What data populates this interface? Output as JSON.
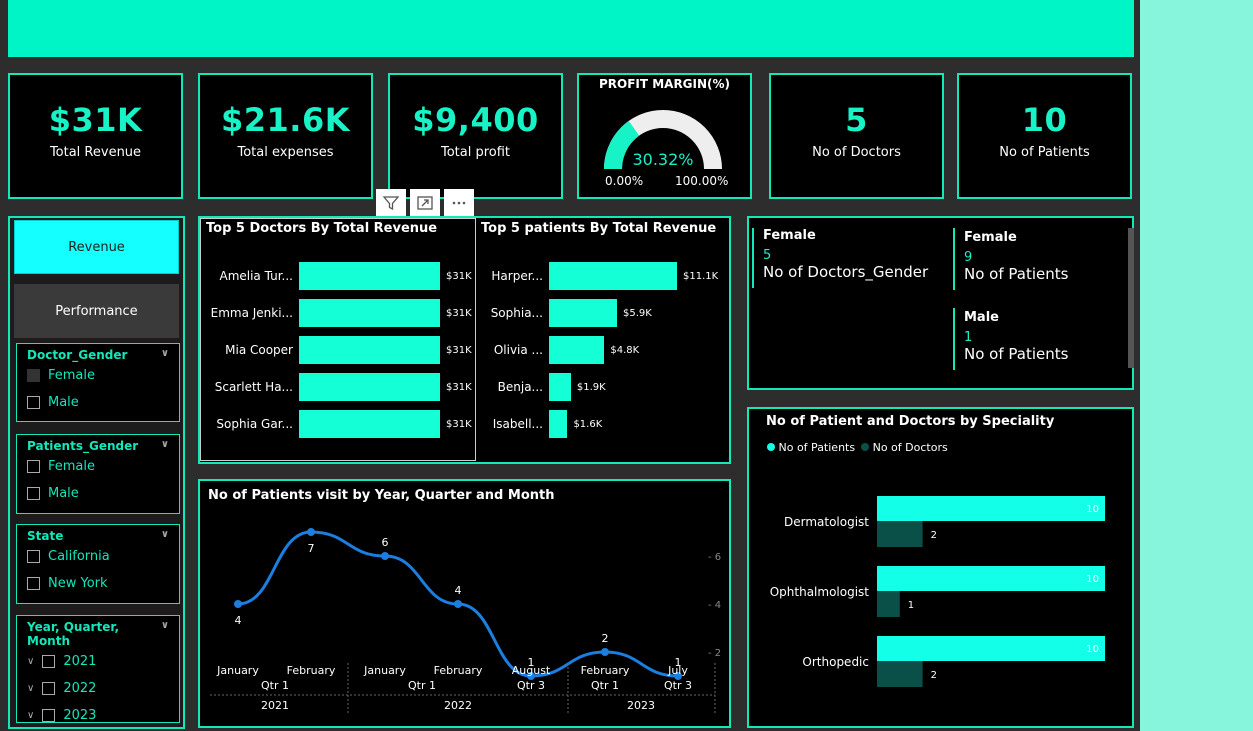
{
  "kpis": [
    {
      "value": "$31K",
      "label": "Total Revenue"
    },
    {
      "value": "$21.6K",
      "label": "Total expenses"
    },
    {
      "value": "$9,400",
      "label": "Total profit"
    },
    {
      "value": "5",
      "label": "No of Doctors"
    },
    {
      "value": "10",
      "label": "No of Patients"
    }
  ],
  "gauge": {
    "title": "PROFIT MARGIN(%)",
    "value": "30.32%",
    "fraction": 0.3032,
    "min": "0.00%",
    "max": "100.00%"
  },
  "nav": {
    "revenue": "Revenue",
    "performance": "Performance"
  },
  "slicers": {
    "doctor_gender": {
      "title": "Doctor_Gender",
      "options": [
        "Female",
        "Male"
      ]
    },
    "patients_gender": {
      "title": "Patients_Gender",
      "options": [
        "Female",
        "Male"
      ]
    },
    "state": {
      "title": "State",
      "options": [
        "California",
        "New York"
      ]
    },
    "year": {
      "title": "Year, Quarter, Month",
      "options": [
        "2021",
        "2022",
        "2023"
      ]
    }
  },
  "doctors_chart": {
    "title": "Top 5 Doctors By Total Revenue",
    "names": [
      "Amelia Tur...",
      "Emma Jenki...",
      "Mia Cooper",
      "Scarlett Ha...",
      "Sophia Gar..."
    ],
    "labels": [
      "$31K",
      "$31K",
      "$31K",
      "$31K",
      "$31K"
    ],
    "values": [
      31,
      31,
      31,
      31,
      31
    ]
  },
  "patients_chart": {
    "title": "Top 5 patients By Total Revenue",
    "names": [
      "Harper...",
      "Sophia...",
      "Olivia ...",
      "Benja...",
      "Isabell..."
    ],
    "labels": [
      "$11.1K",
      "$5.9K",
      "$4.8K",
      "$1.9K",
      "$1.6K"
    ],
    "values": [
      11.1,
      5.9,
      4.8,
      1.9,
      1.6
    ]
  },
  "gender_card": {
    "doc_female_title": "Female",
    "doc_female_value": "5",
    "doc_female_label": "No of Doctors_Gender",
    "pat_female_title": "Female",
    "pat_female_value": "9",
    "pat_female_label": "No of Patients",
    "pat_male_title": "Male",
    "pat_male_value": "1",
    "pat_male_label": "No of Patients"
  },
  "chart_data": [
    {
      "type": "line",
      "title": "No of Patients visit by Year, Quarter and Month",
      "x": [
        "January",
        "February",
        "January",
        "February",
        "August",
        "February",
        "July"
      ],
      "quarters": [
        "Qtr 1",
        "Qtr 1",
        "Qtr 3",
        "Qtr 1",
        "Qtr 3"
      ],
      "years": [
        "2021",
        "2022",
        "2023"
      ],
      "values": [
        4,
        7,
        6,
        4,
        1,
        2,
        1
      ],
      "yticks": [
        "6",
        "4",
        "2"
      ]
    },
    {
      "type": "bar",
      "title": "No of Patient and Doctors by Speciality",
      "categories": [
        "Dermatologist",
        "Ophthalmologist",
        "Orthopedic"
      ],
      "series": [
        {
          "name": "No of Patients",
          "values": [
            10,
            10,
            10
          ],
          "color": "#14ffe8"
        },
        {
          "name": "No of Doctors",
          "values": [
            2,
            1,
            2
          ],
          "color": "#0b4f49"
        }
      ]
    }
  ],
  "colors": {
    "accent": "#13e8b9",
    "header": "#00f5c6",
    "bar": "#14ffd5"
  }
}
